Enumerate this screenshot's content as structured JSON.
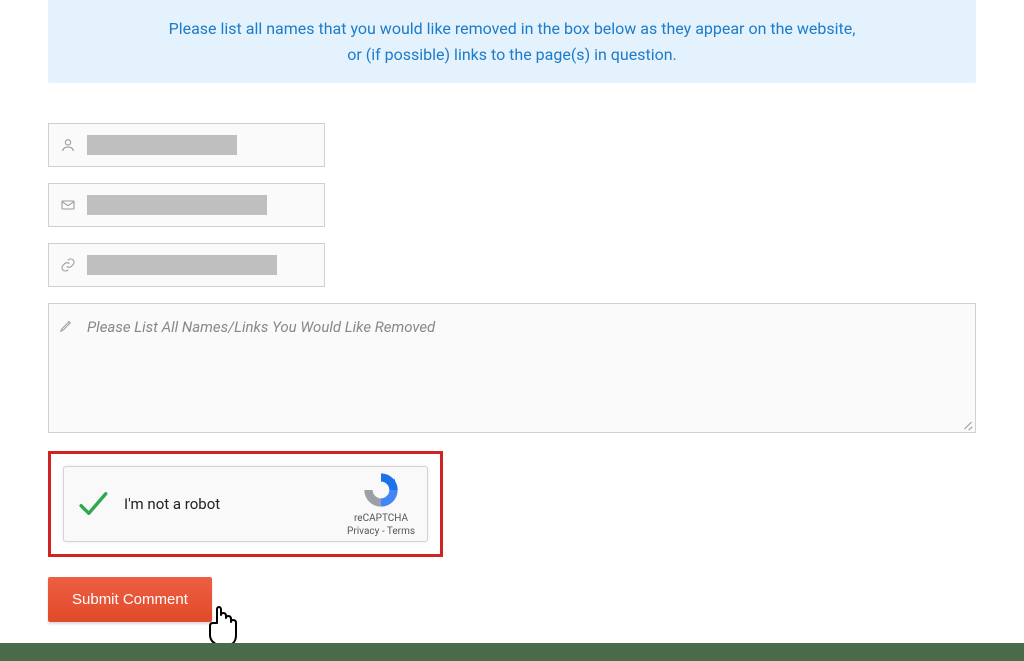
{
  "notice": {
    "line1": "Please list all names that you would like removed in the box below as they appear on the website,",
    "line2": "or (if possible) links to the page(s) in question."
  },
  "form": {
    "textarea_placeholder": "Please List All Names/Links You Would Like Removed"
  },
  "recaptcha": {
    "label": "I'm not a robot",
    "brand": "reCAPTCHA",
    "privacy": "Privacy",
    "terms": "Terms",
    "separator": " - "
  },
  "submit": {
    "label": "Submit Comment"
  }
}
